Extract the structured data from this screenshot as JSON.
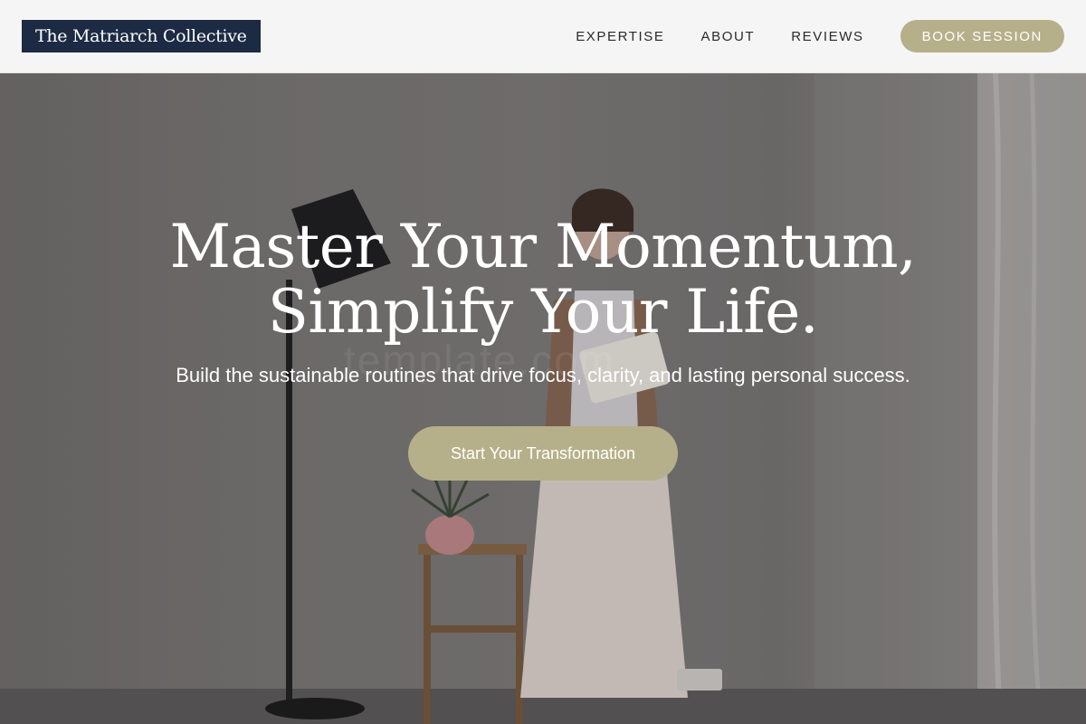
{
  "header": {
    "logo_text": "The Matriarch Collective",
    "nav": [
      {
        "label": "EXPERTISE"
      },
      {
        "label": "ABOUT"
      },
      {
        "label": "REVIEWS"
      }
    ],
    "cta_label": "BOOK SESSION"
  },
  "hero": {
    "headline_line1": "Master Your Momentum,",
    "headline_line2": "Simplify Your Life.",
    "subheadline": "Build the sustainable routines that drive focus, clarity, and lasting personal success.",
    "cta_label": "Start Your Transformation",
    "watermark": "template.com"
  },
  "colors": {
    "logo_bg": "#1c2a44",
    "accent": "#b6b08a",
    "header_bg": "#f5f5f5",
    "text_on_hero": "#ffffff"
  }
}
